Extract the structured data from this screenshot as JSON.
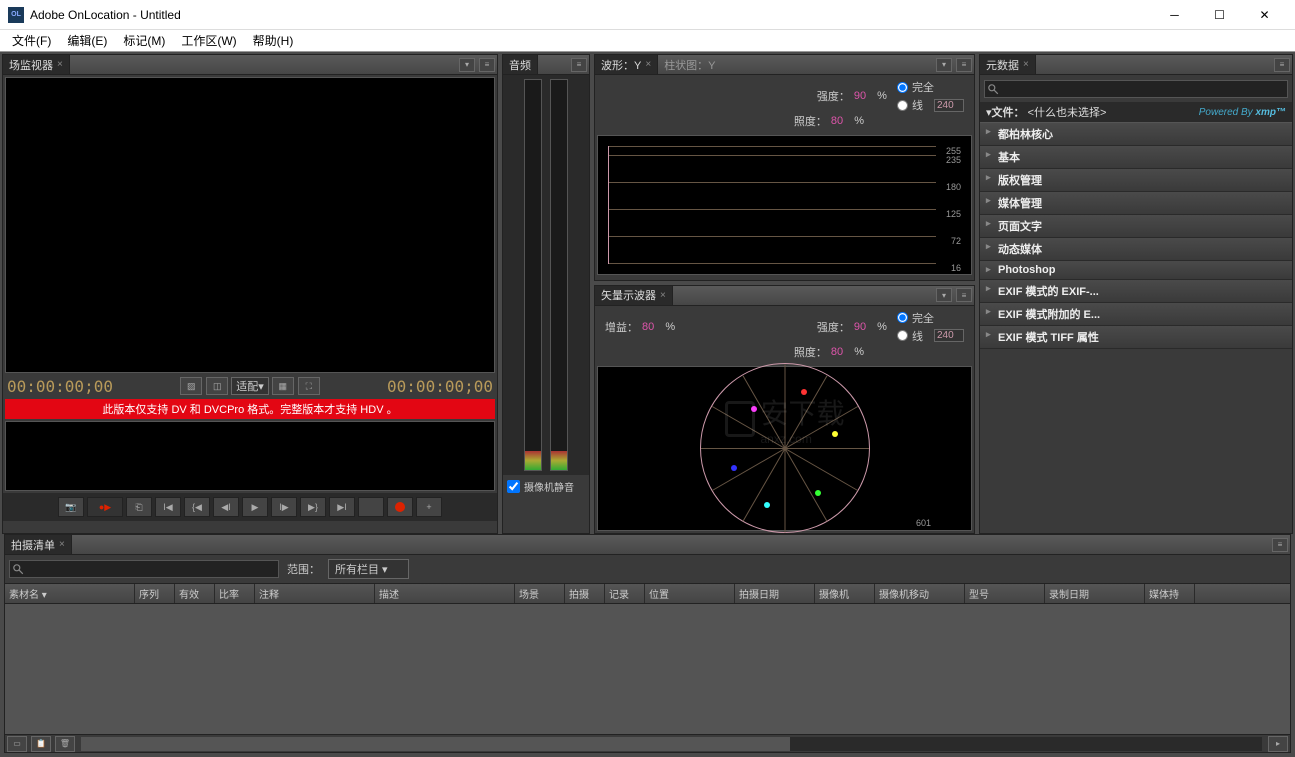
{
  "window": {
    "title": "Adobe OnLocation - Untitled",
    "icon_label": "OL"
  },
  "menu": {
    "file": "文件(F)",
    "edit": "编辑(E)",
    "marker": "标记(M)",
    "workspace": "工作区(W)",
    "help": "帮助(H)"
  },
  "monitor": {
    "tab": "场监视器",
    "tc_left": "00:00:00;00",
    "tc_right": "00:00:00;00",
    "fit_label": "适配",
    "warning": "此版本仅支持 DV 和 DVCPro 格式。完整版本才支持 HDV 。"
  },
  "audio": {
    "tab": "音频",
    "mute_label": "摄像机静音"
  },
  "waveform": {
    "tab_active": "波形：Y",
    "tab_inactive": "柱状图：Y",
    "intensity_label": "强度：",
    "intensity_val": "90",
    "pct": "%",
    "brightness_label": "照度：",
    "brightness_val": "80",
    "opt_full": "完全",
    "opt_line": "线",
    "line_val": "240",
    "ticks": [
      "255",
      "235",
      "180",
      "125",
      "72",
      "16"
    ]
  },
  "vectorscope": {
    "tab": "矢量示波器",
    "gain_label": "增益：",
    "gain_val": "80",
    "intensity_label": "强度：",
    "intensity_val": "90",
    "brightness_label": "照度：",
    "brightness_val": "80",
    "opt_full": "完全",
    "opt_line": "线",
    "line_val": "240",
    "pct": "%",
    "scale_label": "601"
  },
  "metadata": {
    "tab": "元数据",
    "search_placeholder": "",
    "file_label": "文件：",
    "file_none": "<什么也未选择>",
    "powered_by": "Powered By",
    "xmp": "xmp™",
    "cats": [
      "都柏林核心",
      "基本",
      "版权管理",
      "媒体管理",
      "页面文字",
      "动态媒体",
      "Photoshop",
      "EXIF 模式的 EXIF-...",
      "EXIF 模式附加的 E...",
      "EXIF 模式 TIFF 属性"
    ]
  },
  "shotlist": {
    "tab": "拍摄清单",
    "search_placeholder": "",
    "range_label": "范围：",
    "range_value": "所有栏目",
    "columns": [
      "素材名",
      "序列",
      "有效",
      "比率",
      "注释",
      "描述",
      "场景",
      "拍摄",
      "记录",
      "位置",
      "拍摄日期",
      "摄像机",
      "摄像机移动",
      "型号",
      "录制日期",
      "媒体持"
    ]
  },
  "watermark": {
    "text": "安下载",
    "sub": "anxz.com"
  }
}
